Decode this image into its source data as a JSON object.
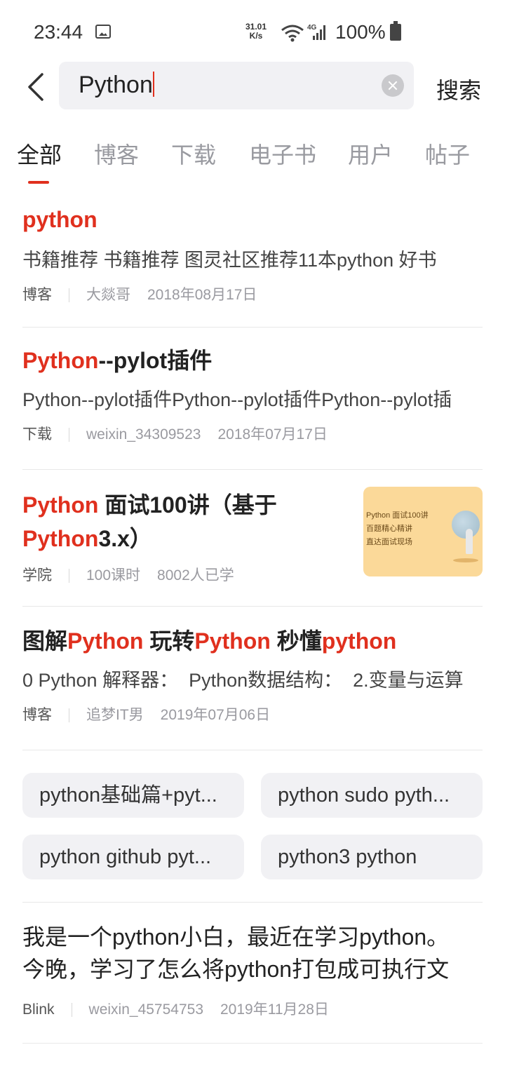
{
  "status_bar": {
    "time": "23:44",
    "net_speed_value": "31.01",
    "net_speed_unit": "K/s",
    "battery": "100%",
    "network_type": "4G"
  },
  "search": {
    "query": "Python",
    "button_label": "搜索"
  },
  "tabs": [
    {
      "label": "全部",
      "active": true
    },
    {
      "label": "博客"
    },
    {
      "label": "下载"
    },
    {
      "label": "电子书"
    },
    {
      "label": "用户"
    },
    {
      "label": "帖子"
    }
  ],
  "results": [
    {
      "title_hl": "python",
      "desc": " 书籍推荐 书籍推荐 图灵社区推荐11本python 好书",
      "type": "博客",
      "author": "大燚哥",
      "date": "2018年08月17日"
    },
    {
      "title_hl": "Python",
      "title_rest": "--pylot插件",
      "desc": "Python--pylot插件Python--pylot插件Python--pylot插",
      "type": "下载",
      "author": "weixin_34309523",
      "date": "2018年07月17日"
    },
    {
      "title_hl1": "Python",
      "title_rest1": " 面试100讲（基于",
      "title_hl2": "Python",
      "title_rest2": "3.x）",
      "type": "学院",
      "lessons": "100课时",
      "learners": "8002人已学",
      "thumb_line1": "Python 面试100讲",
      "thumb_line2": "百题精心精讲",
      "thumb_line3": "直达面试现场"
    },
    {
      "title_p1": "图解",
      "title_hl1": "Python",
      "title_p2": " 玩转",
      "title_hl2": "Python",
      "title_p3": " 秒懂",
      "title_hl3": "python",
      "desc": "0 Python 解释器：  Python数据结构：  2.变量与运算",
      "type": "博客",
      "author": "追梦IT男",
      "date": "2019年07月06日"
    }
  ],
  "related_chips": [
    "python基础篇+pyt...",
    "python sudo pyth...",
    "python github pyt...",
    "python3 python"
  ],
  "result5": {
    "line1": "我是一个python小白，最近在学习python。",
    "line2": "今晚，学习了怎么将python打包成可执行文",
    "type": "Blink",
    "author": "weixin_45754753",
    "date": "2019年11月28日"
  }
}
